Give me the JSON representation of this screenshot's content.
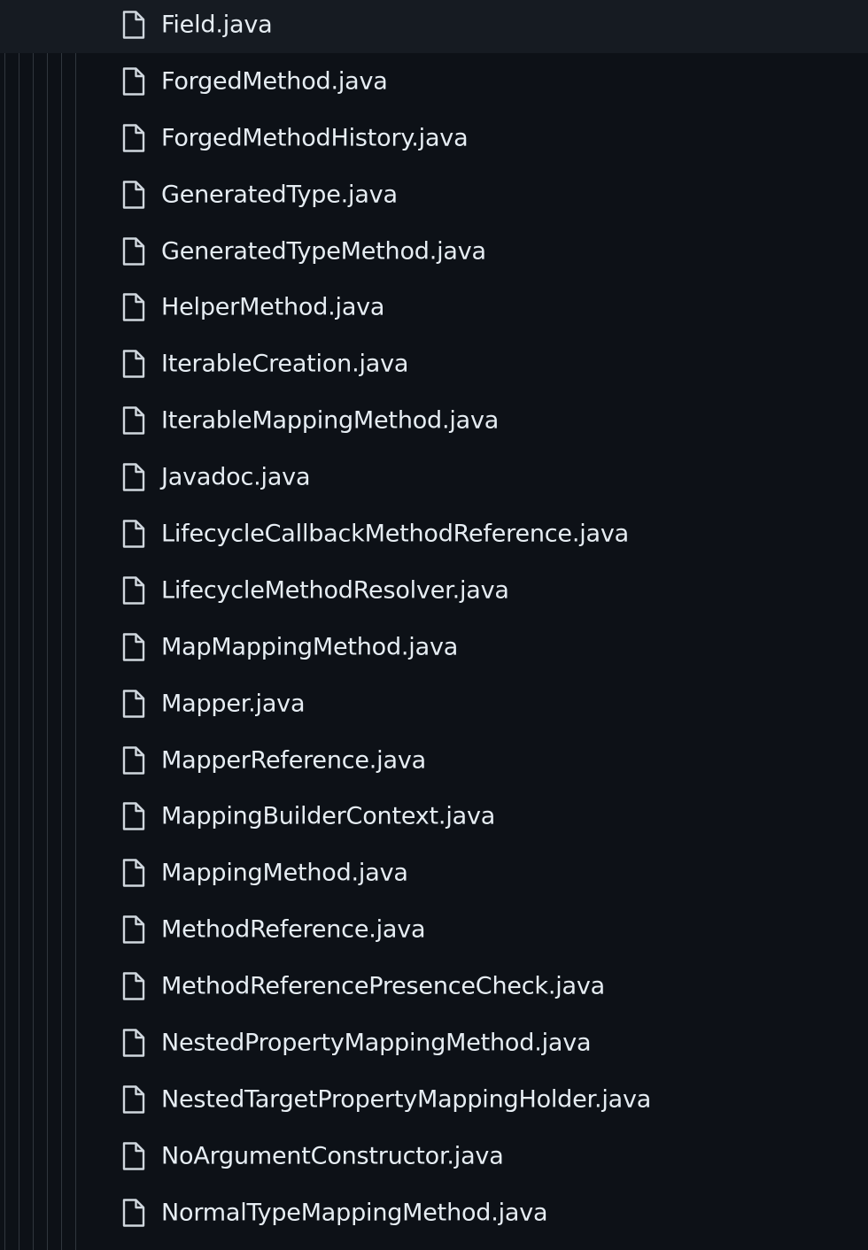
{
  "file_tree": {
    "files": [
      {
        "name": "Field.java",
        "icon": "file-icon"
      },
      {
        "name": "ForgedMethod.java",
        "icon": "file-icon"
      },
      {
        "name": "ForgedMethodHistory.java",
        "icon": "file-icon"
      },
      {
        "name": "GeneratedType.java",
        "icon": "file-icon"
      },
      {
        "name": "GeneratedTypeMethod.java",
        "icon": "file-icon"
      },
      {
        "name": "HelperMethod.java",
        "icon": "file-icon"
      },
      {
        "name": "IterableCreation.java",
        "icon": "file-icon"
      },
      {
        "name": "IterableMappingMethod.java",
        "icon": "file-icon"
      },
      {
        "name": "Javadoc.java",
        "icon": "file-icon"
      },
      {
        "name": "LifecycleCallbackMethodReference.java",
        "icon": "file-icon"
      },
      {
        "name": "LifecycleMethodResolver.java",
        "icon": "file-icon"
      },
      {
        "name": "MapMappingMethod.java",
        "icon": "file-icon"
      },
      {
        "name": "Mapper.java",
        "icon": "file-icon"
      },
      {
        "name": "MapperReference.java",
        "icon": "file-icon"
      },
      {
        "name": "MappingBuilderContext.java",
        "icon": "file-icon"
      },
      {
        "name": "MappingMethod.java",
        "icon": "file-icon"
      },
      {
        "name": "MethodReference.java",
        "icon": "file-icon"
      },
      {
        "name": "MethodReferencePresenceCheck.java",
        "icon": "file-icon"
      },
      {
        "name": "NestedPropertyMappingMethod.java",
        "icon": "file-icon"
      },
      {
        "name": "NestedTargetPropertyMappingHolder.java",
        "icon": "file-icon"
      },
      {
        "name": "NoArgumentConstructor.java",
        "icon": "file-icon"
      },
      {
        "name": "NormalTypeMappingMethod.java",
        "icon": "file-icon"
      }
    ]
  },
  "colors": {
    "background": "#0d1117",
    "hover_row": "#161b22",
    "text": "#e6edf3",
    "icon": "#d0d7de",
    "guide_line": "#30363d"
  }
}
